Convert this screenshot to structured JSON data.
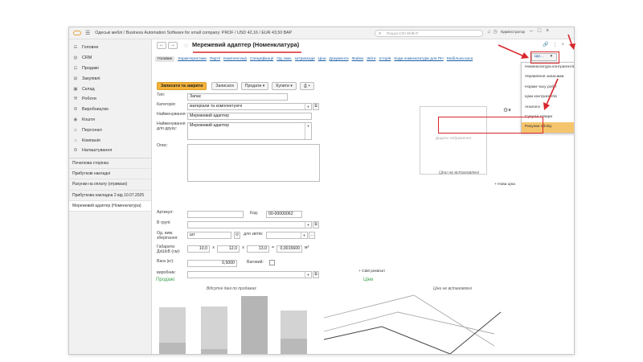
{
  "app": {
    "title": "Одеські меблі / Business Automation Software for small company: PROF / USD 42,16 / EUR 43,50 ВАР",
    "search_placeholder": "Пошук Ctrl+Shift+F",
    "user": "Адміністратор"
  },
  "sidebar": {
    "items": [
      {
        "label": "Головне",
        "icon": "home-icon"
      },
      {
        "label": "CRM",
        "icon": "crm-icon"
      },
      {
        "label": "Продажі",
        "icon": "sales-icon"
      },
      {
        "label": "Закупівлі",
        "icon": "purchases-icon"
      },
      {
        "label": "Склад",
        "icon": "warehouse-icon"
      },
      {
        "label": "Роботи",
        "icon": "works-icon"
      },
      {
        "label": "Виробництво",
        "icon": "production-icon"
      },
      {
        "label": "Кошти",
        "icon": "money-icon"
      },
      {
        "label": "Персонал",
        "icon": "staff-icon"
      },
      {
        "label": "Компанія",
        "icon": "company-icon"
      },
      {
        "label": "Налаштування",
        "icon": "settings-icon"
      }
    ],
    "open_windows": [
      {
        "label": "Початкова сторінка"
      },
      {
        "label": "Прибуткові накладні"
      },
      {
        "label": "Рахунки на оплату (отримані)"
      },
      {
        "label": "Прибуткова накладна 2 від 10.07.2025"
      },
      {
        "label": "Мережевий адаптер (Номенклатура)"
      }
    ]
  },
  "form": {
    "title": "Мережевий адаптер (Номенклатура)",
    "tabs": [
      "Головне",
      "Характеристики",
      "Партії",
      "Комплектації",
      "Специфікації",
      "Од. вим.",
      "Штрихкоди",
      "Ціни",
      "Документи",
      "Файли",
      "Звіти",
      "Історія",
      "Коди номенклатури для ПН",
      "Мобільна каса"
    ],
    "more_label": "Ще...",
    "buttons": {
      "save_close": "Записати та закрити",
      "save": "Записати",
      "sales": "Продати",
      "buy": "Купити",
      "print": "⎙",
      "more": "Ще",
      "help": "?"
    },
    "fields": {
      "type_label": "Тип:",
      "type_value": "Запас",
      "category_label": "Категорія:",
      "category_value": "матеріали та комплектуючі",
      "name_label": "Найменування:",
      "name_value": "Мережевий адаптер",
      "print_name_label": "Найменування для друку:",
      "print_name_value": "Мережевий адаптер",
      "desc_label": "Опис:",
      "article_label": "Артикул:",
      "article_value": "",
      "code_label": "Код:",
      "code_value": "00-00000062",
      "group_label": "В групі:",
      "unit_label": "Од. вим. зберігання:",
      "unit_value": "шт",
      "for_report_label": "для звітів:",
      "dims_label": "Габарити ДхШхВ (см):",
      "dim_l": "10,0",
      "dim_w": "12,0",
      "dim_h": "13,0",
      "volume": "0,0015600",
      "volume_unit": "м³",
      "x1": "х",
      "x2": "х",
      "eq": "=",
      "weight_label": "Вага (кг):",
      "weight_value": "0,5000",
      "weighted_label": "Ваговий:",
      "manufacturer_label": "виробник:",
      "add_requisite": "+ Свій реквізит"
    },
    "picture_placeholder": "Додати зображення",
    "prices_not_set": "Ціни не встановлені",
    "new_price": "+ Нова ціна",
    "sales_title": "Продажі",
    "sales_caption": "Відсутні дані по продажах",
    "prices_title": "Ціни",
    "prices_caption": "Ціни не встановлені"
  },
  "dropdown": {
    "items": [
      "Номенклатура контрагентів",
      "Управління запасами",
      "Норми часу робіт",
      "Ціни контрагентів",
      "Аналоги",
      "Супутні товари",
      "Рахунки обліку"
    ],
    "highlighted": "Рахунки обліку"
  },
  "colors": {
    "primary_button": "#f3b33d",
    "highlight": "#f5c56d",
    "annotation": "#d8262c",
    "section_green": "#3ca14b",
    "link": "#1a5fa6"
  }
}
